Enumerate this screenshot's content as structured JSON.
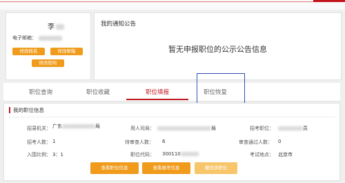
{
  "profile": {
    "name": "李",
    "email_label": "电子邮箱：",
    "buttons": {
      "edit_name": "修改姓名",
      "edit_email": "修改邮箱",
      "edit_password": "修改密码"
    }
  },
  "notice": {
    "title": "我的通知公告",
    "message": "暂无申报职位的公示公告信息"
  },
  "tabs": [
    {
      "label": "职位查询"
    },
    {
      "label": "职位收藏"
    },
    {
      "label": "职位填报",
      "active": true
    },
    {
      "label": "职位恢复"
    }
  ],
  "info": {
    "title": "我的职位信息",
    "rows": [
      {
        "l1": "招录机关：",
        "v1": "广东",
        "v1b": "局",
        "l2": "用人司局：",
        "v2b": "局",
        "l3": "招考职位：",
        "v3b": "员"
      },
      {
        "l1": "招考人数：",
        "v1": "1",
        "l2": "待审查人数：",
        "v2": "6",
        "l3": "审查通过人数：",
        "v3": "0"
      },
      {
        "l1": "入围比例：",
        "v1": "3：1",
        "l2": "职位代码：",
        "v2": "300110",
        "l3": "考试地点：",
        "v3": "北京市"
      }
    ],
    "buttons": {
      "view_position": "查看职位信息",
      "view_application": "查看报考信息",
      "cancel_application": "撤回该职位"
    }
  },
  "colors": {
    "accent_red": "#c2161d",
    "orange": "#f09b1b",
    "highlight_blue": "#2d4fb5"
  }
}
